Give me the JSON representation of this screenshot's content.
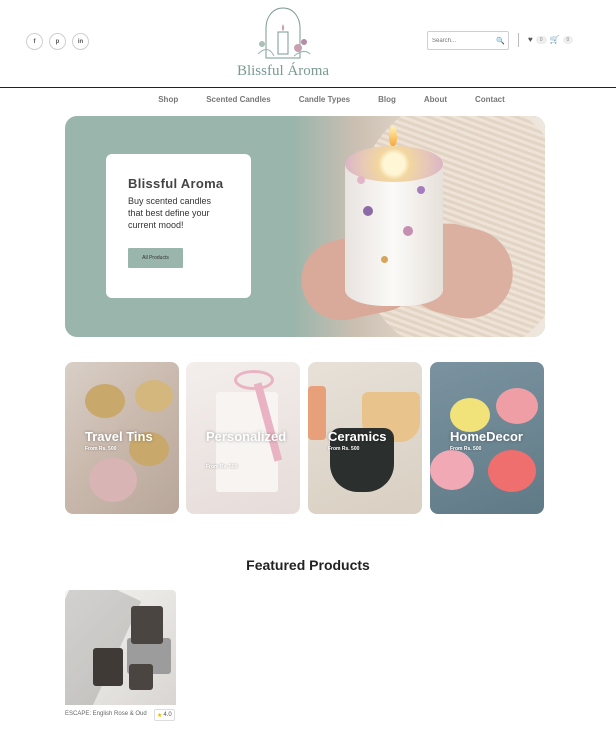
{
  "brand": {
    "name": "Blissful Ároma"
  },
  "social": [
    {
      "icon": "facebook-icon",
      "glyph": "f"
    },
    {
      "icon": "pinterest-icon",
      "glyph": "p"
    },
    {
      "icon": "linkedin-icon",
      "glyph": "in"
    }
  ],
  "header": {
    "search_placeholder": "Search...",
    "wishlist_count": "0",
    "cart_count": "0"
  },
  "nav": [
    "Shop",
    "Scented Candles",
    "Candle Types",
    "Blog",
    "About",
    "Contact"
  ],
  "hero": {
    "title": "Blissful Aroma",
    "subtitle": "Buy scented candles that best define your current mood!",
    "cta": "All Products"
  },
  "categories": [
    {
      "title": "Travel Tins",
      "sub": "From Rs. 500"
    },
    {
      "title": "Personalized",
      "sub": "From Rs. 500"
    },
    {
      "title": "Ceramics",
      "sub": "From Rs. 500"
    },
    {
      "title": "HomeDecor",
      "sub": "From Rs. 500"
    }
  ],
  "featured": {
    "title": "Featured Products",
    "products": [
      {
        "name": "ESCAPE: English Rose & Oud",
        "rating": "4.0"
      }
    ]
  },
  "colors": {
    "accent": "#9ab5ac",
    "logo": "#7a9a92",
    "star": "#f0b400"
  }
}
